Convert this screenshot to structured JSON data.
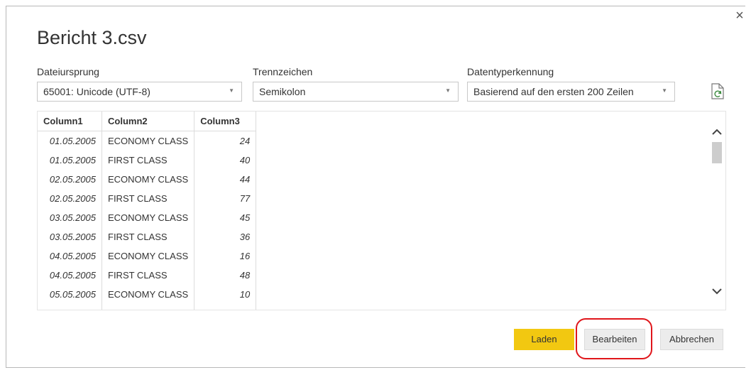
{
  "dialog": {
    "title": "Bericht 3.csv",
    "close_glyph": "×"
  },
  "options": {
    "file_origin": {
      "label": "Dateiursprung",
      "value": "65001: Unicode (UTF-8)"
    },
    "delimiter": {
      "label": "Trennzeichen",
      "value": "Semikolon"
    },
    "type_detection": {
      "label": "Datentyperkennung",
      "value": "Basierend auf den ersten 200 Zeilen"
    },
    "refresh_icon": "refresh-document-icon"
  },
  "preview": {
    "columns": [
      "Column1",
      "Column2",
      "Column3"
    ],
    "rows": [
      [
        "01.05.2005",
        "ECONOMY CLASS",
        "24"
      ],
      [
        "01.05.2005",
        "FIRST CLASS",
        "40"
      ],
      [
        "02.05.2005",
        "ECONOMY CLASS",
        "44"
      ],
      [
        "02.05.2005",
        "FIRST CLASS",
        "77"
      ],
      [
        "03.05.2005",
        "ECONOMY CLASS",
        "45"
      ],
      [
        "03.05.2005",
        "FIRST CLASS",
        "36"
      ],
      [
        "04.05.2005",
        "ECONOMY CLASS",
        "16"
      ],
      [
        "04.05.2005",
        "FIRST CLASS",
        "48"
      ],
      [
        "05.05.2005",
        "ECONOMY CLASS",
        "10"
      ]
    ]
  },
  "buttons": {
    "load": "Laden",
    "edit": "Bearbeiten",
    "cancel": "Abbrechen"
  },
  "colors": {
    "accent_yellow": "#f2c811",
    "highlight_red": "#e0161b"
  }
}
